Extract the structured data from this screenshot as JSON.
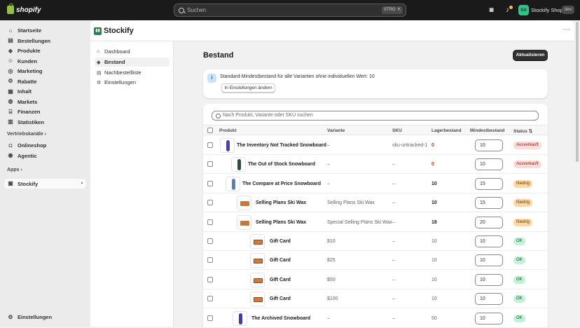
{
  "topbar": {
    "brand": "shopify",
    "search_placeholder": "Suchen",
    "shortcut_key1": "STRG",
    "shortcut_key2": "K",
    "avatar_initials": "SS",
    "shop_name": "Stockify Shop",
    "dev_badge": "dev"
  },
  "nav": {
    "items": [
      {
        "label": "Startseite",
        "icon": "home-icon"
      },
      {
        "label": "Bestellungen",
        "icon": "inbox-icon"
      },
      {
        "label": "Produkte",
        "icon": "tag-icon"
      },
      {
        "label": "Kunden",
        "icon": "person-icon"
      },
      {
        "label": "Marketing",
        "icon": "target-icon"
      },
      {
        "label": "Rabatte",
        "icon": "discount-icon"
      },
      {
        "label": "Inhalt",
        "icon": "content-icon"
      },
      {
        "label": "Markets",
        "icon": "globe-icon"
      },
      {
        "label": "Finanzen",
        "icon": "bank-icon"
      },
      {
        "label": "Statistiken",
        "icon": "chart-icon"
      }
    ],
    "channels_label": "Vertriebskanäle",
    "channels": [
      {
        "label": "Onlineshop",
        "icon": "store-icon"
      },
      {
        "label": "Agentic",
        "icon": "agent-icon"
      }
    ],
    "apps_label": "Apps",
    "apps": [
      {
        "label": "Stockify",
        "icon": "app-icon"
      }
    ],
    "settings_label": "Einstellungen"
  },
  "app": {
    "title": "Stockify",
    "subnav": [
      {
        "label": "Dashboard",
        "active": false
      },
      {
        "label": "Bestand",
        "active": true
      },
      {
        "label": "Nachbestellliste",
        "active": false
      },
      {
        "label": "Einstellungen",
        "active": false
      }
    ]
  },
  "page": {
    "title": "Bestand",
    "refresh_button": "Aktualisieren",
    "info_text": "Standard-Mindestbestand für alle Varianten ohne individuellen Wert: 10",
    "info_button": "In Einstellungen ändern",
    "search_placeholder": "Nach Produkt, Variante oder SKU suchen"
  },
  "table": {
    "headers": [
      "Produkt",
      "Variante",
      "SKU",
      "Lagerbestand",
      "Mindestbestand",
      "Status"
    ],
    "rows": [
      {
        "product": "The Inventory Not Tracked Snowboard",
        "variant": "–",
        "sku": "sku-untracked-1",
        "stock": "0",
        "min": "10",
        "status": "Ausverkauft",
        "tone": "red",
        "thumb": "board",
        "color": "#4b3fb5"
      },
      {
        "product": "The Out of Stock Snowboard",
        "variant": "–",
        "sku": "–",
        "stock": "0",
        "min": "10",
        "status": "Ausverkauft",
        "tone": "red",
        "thumb": "board",
        "color": "#2f4b48"
      },
      {
        "product": "The Compare at Price Snowboard",
        "variant": "–",
        "sku": "–",
        "stock": "10",
        "min": "15",
        "status": "Niedrig",
        "tone": "orange",
        "thumb": "board",
        "color": "#5c7fb8"
      },
      {
        "product": "Selling Plans Ski Wax",
        "variant": "Selling Plans Ski Wax",
        "sku": "–",
        "stock": "10",
        "min": "15",
        "status": "Niedrig",
        "tone": "orange",
        "thumb": "wax",
        "color": "#c8773a"
      },
      {
        "product": "Selling Plans Ski Wax",
        "variant": "Special Selling Plans Ski Wax",
        "sku": "–",
        "stock": "18",
        "min": "20",
        "status": "Niedrig",
        "tone": "orange",
        "thumb": "wax",
        "color": "#c8773a"
      },
      {
        "product": "Gift Card",
        "variant": "$10",
        "sku": "–",
        "stock": "10",
        "min": "10",
        "status": "OK",
        "tone": "green",
        "thumb": "gift",
        "color": "#d17b3f"
      },
      {
        "product": "Gift Card",
        "variant": "$25",
        "sku": "–",
        "stock": "10",
        "min": "10",
        "status": "OK",
        "tone": "green",
        "thumb": "gift",
        "color": "#d17b3f"
      },
      {
        "product": "Gift Card",
        "variant": "$50",
        "sku": "–",
        "stock": "10",
        "min": "10",
        "status": "OK",
        "tone": "green",
        "thumb": "gift",
        "color": "#d17b3f"
      },
      {
        "product": "Gift Card",
        "variant": "$100",
        "sku": "–",
        "stock": "10",
        "min": "10",
        "status": "OK",
        "tone": "green",
        "thumb": "gift",
        "color": "#d17b3f"
      },
      {
        "product": "The Archived Snowboard",
        "variant": "–",
        "sku": "–",
        "stock": "50",
        "min": "10",
        "status": "OK",
        "tone": "green",
        "thumb": "board",
        "color": "#3b3ea8"
      }
    ]
  }
}
